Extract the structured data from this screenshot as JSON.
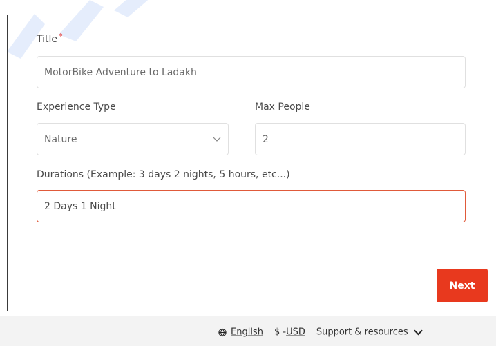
{
  "form": {
    "title_label": "Title",
    "title_required_mark": "*",
    "title_value": "MotorBike Adventure to Ladakh",
    "experience_type_label": "Experience Type",
    "experience_type_value": "Nature",
    "max_people_label": "Max People",
    "max_people_value": "2",
    "durations_label": "Durations (Example: 3 days 2 nights, 5 hours, etc...)",
    "durations_value": "2 Days 1 Night"
  },
  "actions": {
    "next_label": "Next"
  },
  "footer": {
    "language_label": "English",
    "currency_symbol": "$ - ",
    "currency_label": "USD",
    "support_label": "Support & resources"
  },
  "colors": {
    "accent": "#e8391e",
    "active_border": "#e05a3a",
    "required": "#e53935"
  },
  "icons": {
    "select_chevron": "chevron-down-icon",
    "language": "globe-icon",
    "support_chevron": "chevron-down-icon"
  }
}
